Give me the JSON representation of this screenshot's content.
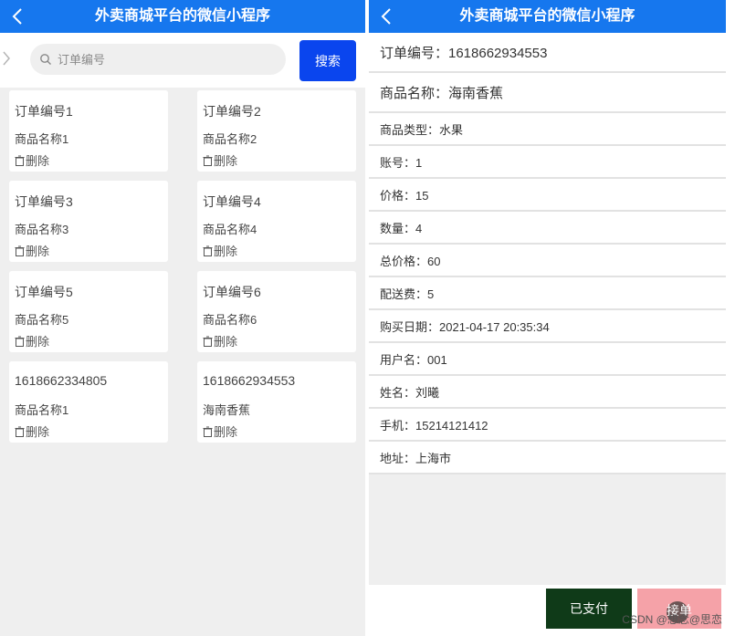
{
  "app_title": "外卖商城平台的微信小程序",
  "list_page": {
    "search": {
      "placeholder": "订单编号",
      "button_label": "搜索"
    },
    "delete_label": "删除",
    "cards": [
      {
        "order_no": "订单编号1",
        "product_name": "商品名称1"
      },
      {
        "order_no": "订单编号2",
        "product_name": "商品名称2"
      },
      {
        "order_no": "订单编号3",
        "product_name": "商品名称3"
      },
      {
        "order_no": "订单编号4",
        "product_name": "商品名称4"
      },
      {
        "order_no": "订单编号5",
        "product_name": "商品名称5"
      },
      {
        "order_no": "订单编号6",
        "product_name": "商品名称6"
      },
      {
        "order_no": "1618662334805",
        "product_name": "商品名称1"
      },
      {
        "order_no": "1618662934553",
        "product_name": "海南香蕉"
      }
    ]
  },
  "detail_page": {
    "fields": {
      "order_no": "订单编号：1618662934553",
      "product_name": "商品名称：海南香蕉",
      "product_type": "商品类型：水果",
      "account": "账号：1",
      "price": "价格：15",
      "quantity": "数量：4",
      "total_price": "总价格：60",
      "delivery_fee": "配送费：5",
      "purchase_date": "购买日期：2021-04-17 20:35:34",
      "username": "用户名：001",
      "name": "姓名：刘曦",
      "phone": "手机：15214121412",
      "address": "地址：上海市"
    },
    "paid_button": "已支付",
    "second_button": "接单"
  },
  "watermark": "CSDN @想念@思恋",
  "colors": {
    "header": "#1677ee",
    "search_button": "#0a45ee",
    "paid_button": "#0f3a18",
    "second_button": "#f5a2a8"
  }
}
